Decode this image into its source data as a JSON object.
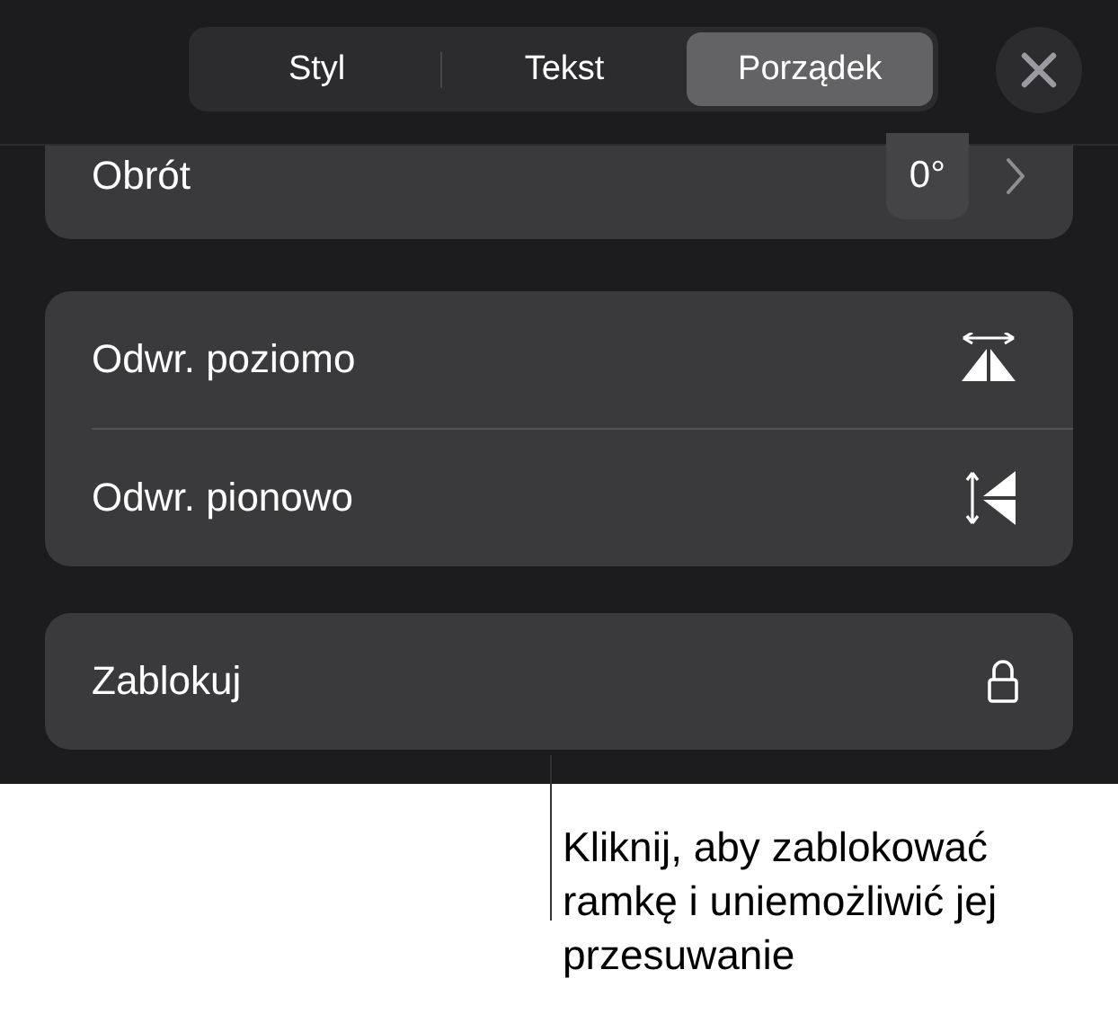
{
  "tabs": [
    {
      "label": "Styl",
      "selected": false
    },
    {
      "label": "Tekst",
      "selected": false
    },
    {
      "label": "Porządek",
      "selected": true
    }
  ],
  "rotation": {
    "label": "Obrót",
    "value": "0°"
  },
  "flip_rows": [
    {
      "label": "Odwr. poziomo",
      "kind": "horizontal"
    },
    {
      "label": "Odwr. pionowo",
      "kind": "vertical"
    }
  ],
  "lock_row": {
    "label": "Zablokuj"
  },
  "callout": "Kliknij, aby zablokować ramkę i uniemożliwić jej przesuwanie"
}
